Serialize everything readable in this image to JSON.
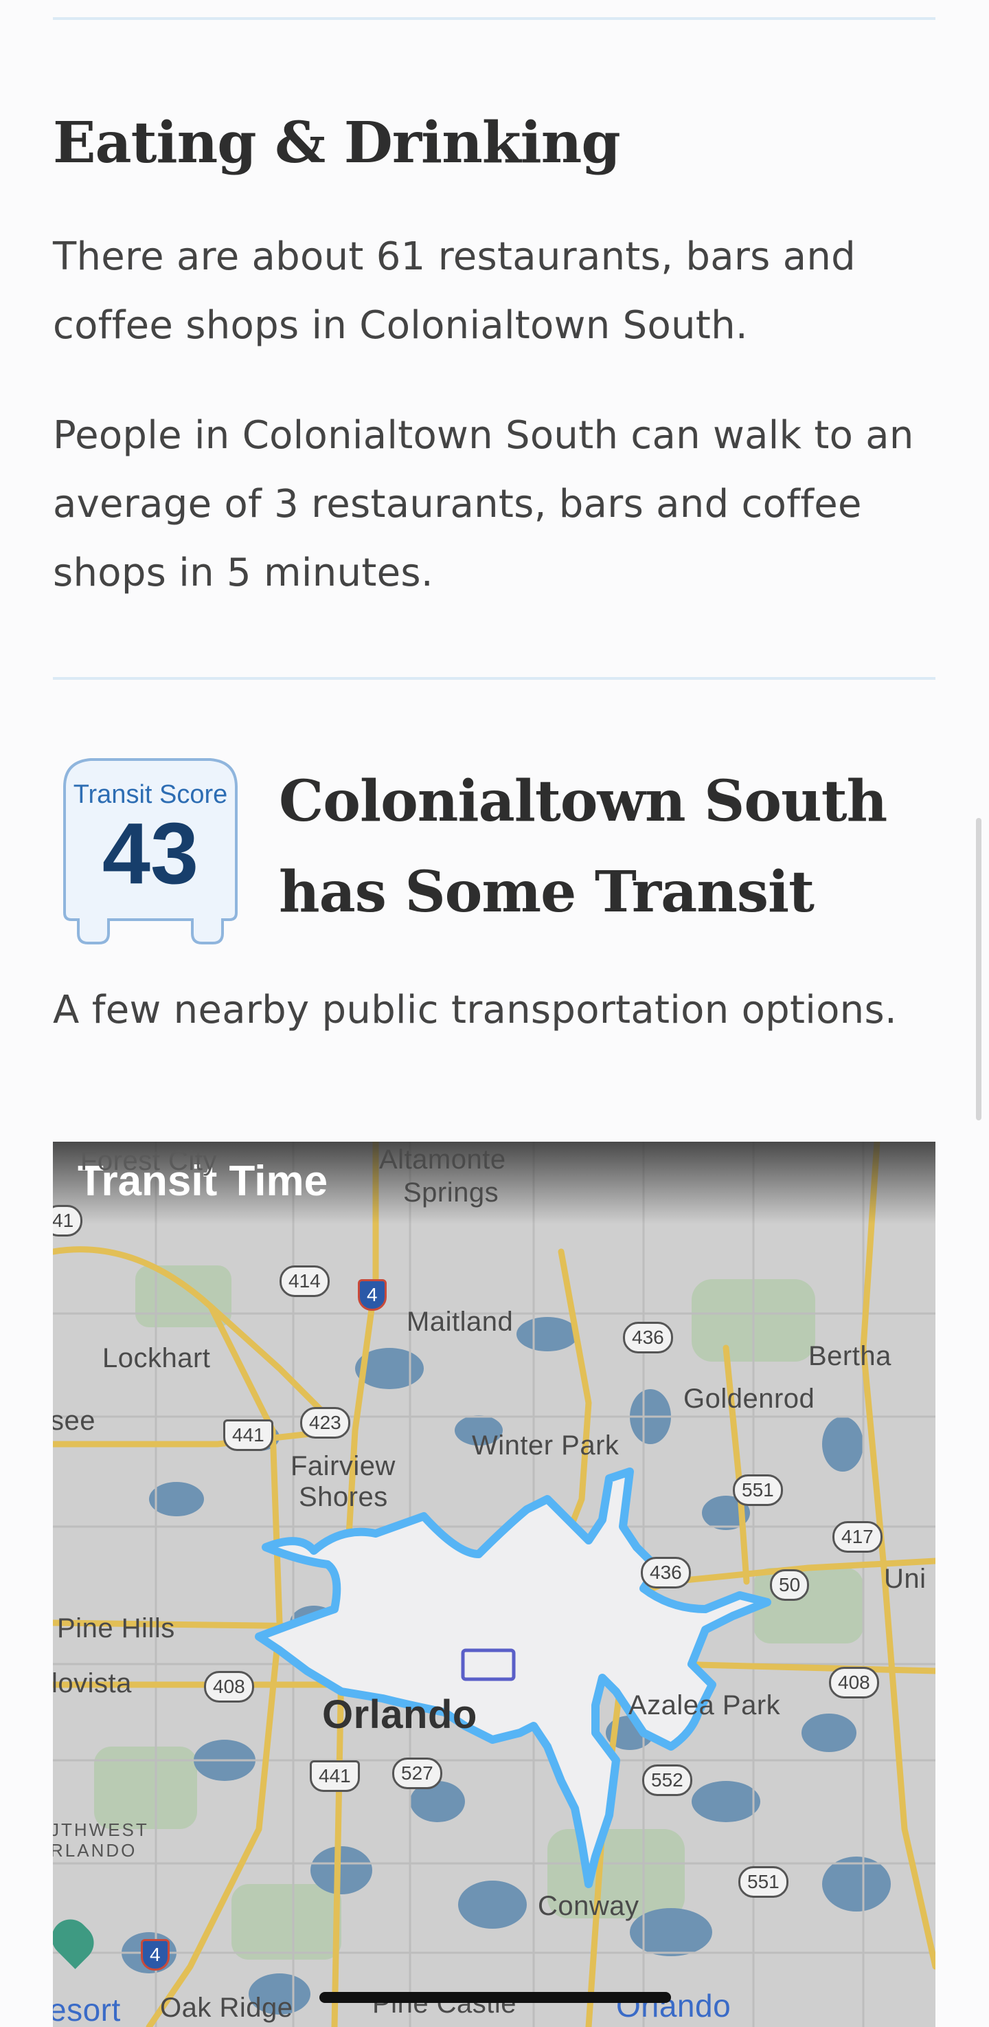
{
  "eating": {
    "heading": "Eating & Drinking",
    "para1_line1": "There are about 61 restaurants, bars and",
    "para1_line2": "coffee shops in Colonialtown South.",
    "para2_line1": "People in Colonialtown South can walk to an",
    "para2_line2": "average of 3 restaurants, bars and coffee",
    "para2_line3": "shops in 5 minutes."
  },
  "transit": {
    "badge_label": "Transit Score",
    "badge_value": "43",
    "title_line1": "Colonialtown South",
    "title_line2": "has Some Transit",
    "description": "A few nearby public transportation options."
  },
  "map": {
    "title": "Transit Time",
    "places": {
      "forest_city": "Forest City",
      "altamonte": "Altamonte",
      "springs": "Springs",
      "maitland": "Maitland",
      "lockhart": "Lockhart",
      "bertha": "Bertha",
      "goldenrod": "Goldenrod",
      "see": "see",
      "winter_park": "Winter Park",
      "fairview": "Fairview",
      "shores": "Shores",
      "uni": "Uni",
      "pine_hills": "Pine Hills",
      "lovista": "lovista",
      "orlando": "Orlando",
      "azalea_park": "Azalea Park",
      "southwest": "JTHWEST",
      "orlando_small": "RLANDO",
      "conway": "Conway",
      "resort": "esort",
      "oak_ridge": "Oak Ridge",
      "pine_castle": "Pine Castle",
      "orlando_bottom": "Orlando"
    },
    "routes": {
      "r441_top": "41",
      "r414": "414",
      "i4_top": "4",
      "r436_top": "436",
      "r423": "423",
      "r441_mid": "441",
      "r551_top": "551",
      "r417": "417",
      "r436_mid": "436",
      "r50": "50",
      "r408_left": "408",
      "r408_right": "408",
      "r441_bottom": "441",
      "r527": "527",
      "r552": "552",
      "r551_bottom": "551",
      "i4_bottom": "4"
    },
    "colors": {
      "isochrone_fill": "#efeff1",
      "isochrone_outline": "#56b4f5",
      "highway": "#e2bf56",
      "water": "#6e93b3",
      "land": "#cfcfcf"
    }
  }
}
